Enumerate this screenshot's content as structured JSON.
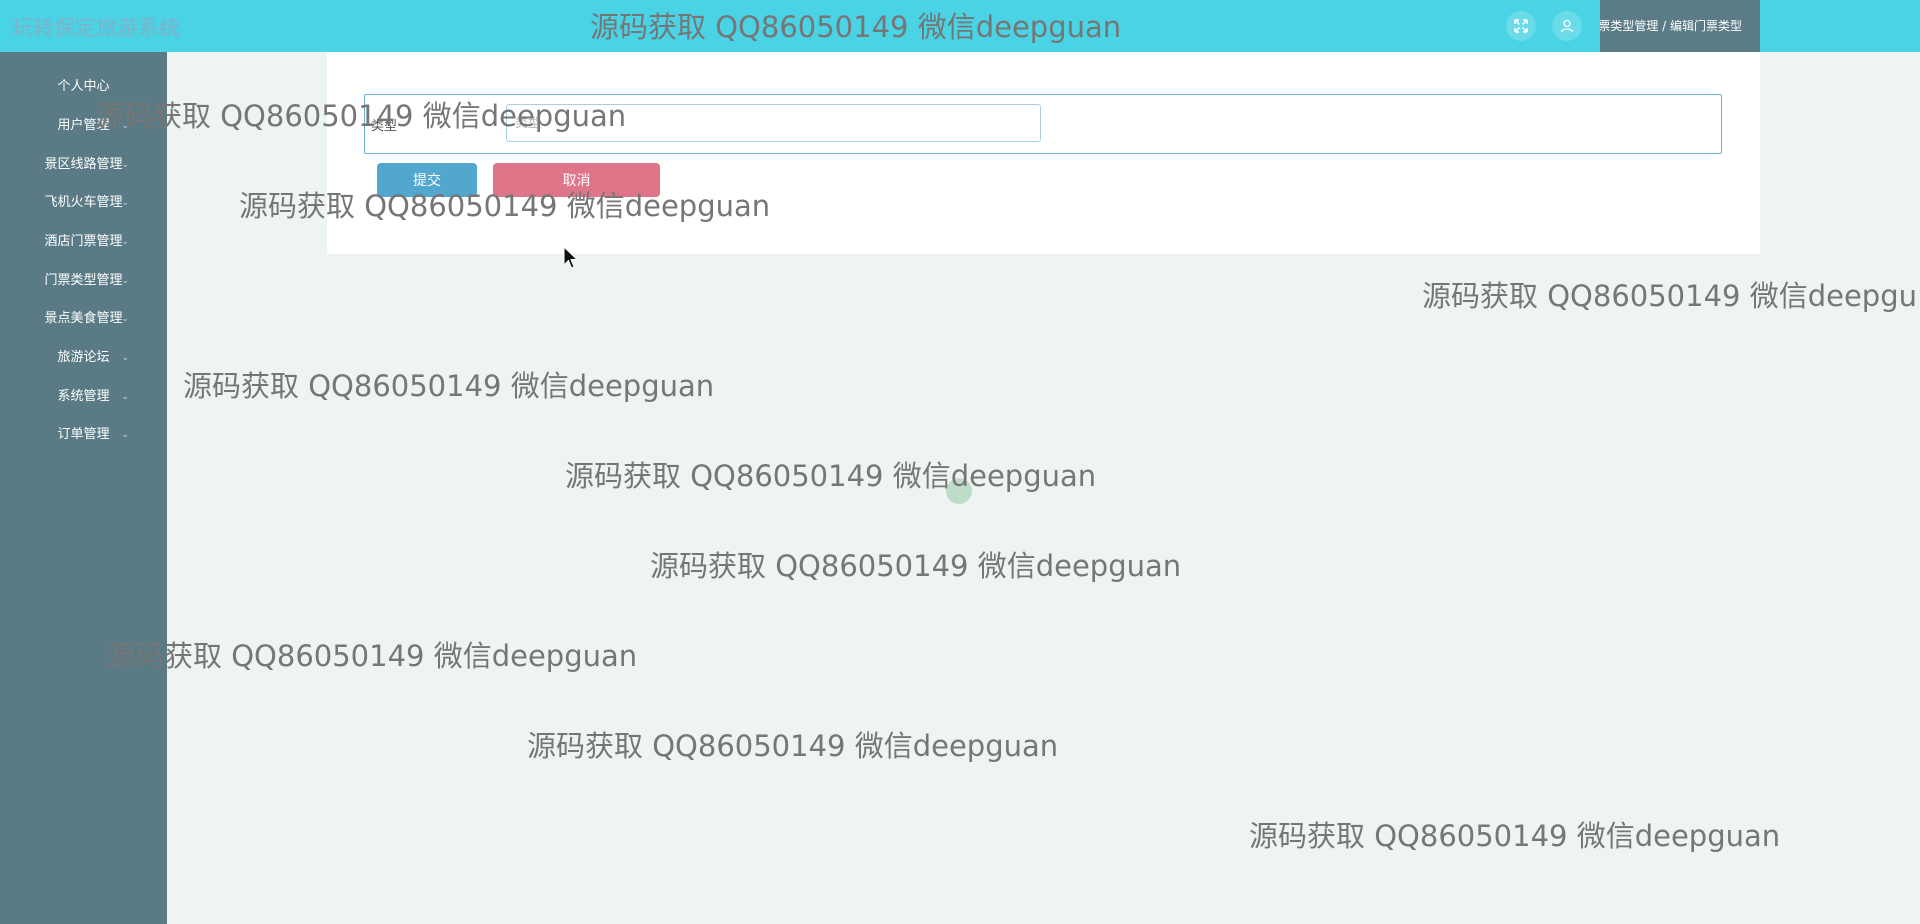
{
  "app": {
    "title": "玩转保定旅游系统"
  },
  "header": {
    "fullscreen_icon": "expand-icon",
    "user_icon": "user-icon",
    "breadcrumb": "门票类型管理 / 编辑门票类型"
  },
  "sidebar": {
    "items": [
      {
        "label": "个人中心"
      },
      {
        "label": "用户管理"
      },
      {
        "label": "景区线路管理"
      },
      {
        "label": "飞机火车管理"
      },
      {
        "label": "酒店门票管理"
      },
      {
        "label": "门票类型管理"
      },
      {
        "label": "景点美食管理"
      },
      {
        "label": "旅游论坛"
      },
      {
        "label": "系统管理"
      },
      {
        "label": "订单管理"
      }
    ]
  },
  "form": {
    "type_label": "类型",
    "type_placeholder": "类型",
    "type_value": "",
    "submit_label": "提交",
    "cancel_label": "取消"
  },
  "watermark": {
    "text": "源码获取 QQ86050149 微信deepguan",
    "text_cut": "源码获取 QQ86050149 微信deepgu"
  },
  "colors": {
    "header": "#4ad3e4",
    "sidebar": "#5a7b86",
    "submit": "#52a7cf",
    "cancel": "#df7589"
  }
}
